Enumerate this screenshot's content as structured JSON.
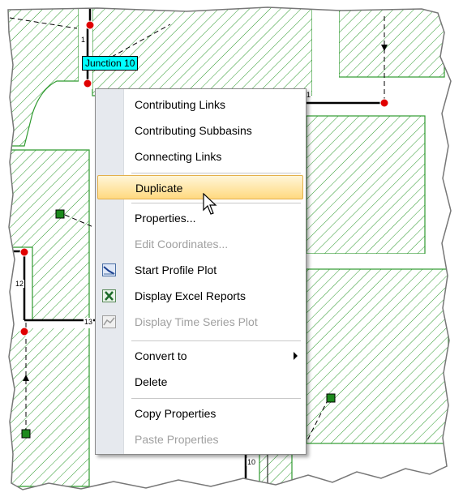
{
  "map": {
    "junction_label": "Junction 10",
    "link_numbers": [
      "1",
      "1",
      "12",
      "13",
      "10"
    ],
    "hatch_color": "#2e9a2e",
    "node_color": "#e00000"
  },
  "context_menu": {
    "items": [
      {
        "label": "Contributing Links",
        "enabled": true
      },
      {
        "label": "Contributing Subbasins",
        "enabled": true
      },
      {
        "label": "Connecting Links",
        "enabled": true
      },
      {
        "label": "Duplicate",
        "enabled": true,
        "highlighted": true
      },
      {
        "label": "Properties...",
        "enabled": true
      },
      {
        "label": "Edit Coordinates...",
        "enabled": false
      },
      {
        "label": "Start Profile Plot",
        "enabled": true,
        "icon": "profile-plot-icon"
      },
      {
        "label": "Display Excel Reports",
        "enabled": true,
        "icon": "excel-icon"
      },
      {
        "label": "Display Time Series Plot",
        "enabled": false,
        "icon": "time-series-icon"
      },
      {
        "label": "Convert to",
        "enabled": true,
        "submenu": true
      },
      {
        "label": "Delete",
        "enabled": true
      },
      {
        "label": "Copy Properties",
        "enabled": true
      },
      {
        "label": "Paste Properties",
        "enabled": false
      }
    ],
    "highlight_color": "#ffd980"
  }
}
